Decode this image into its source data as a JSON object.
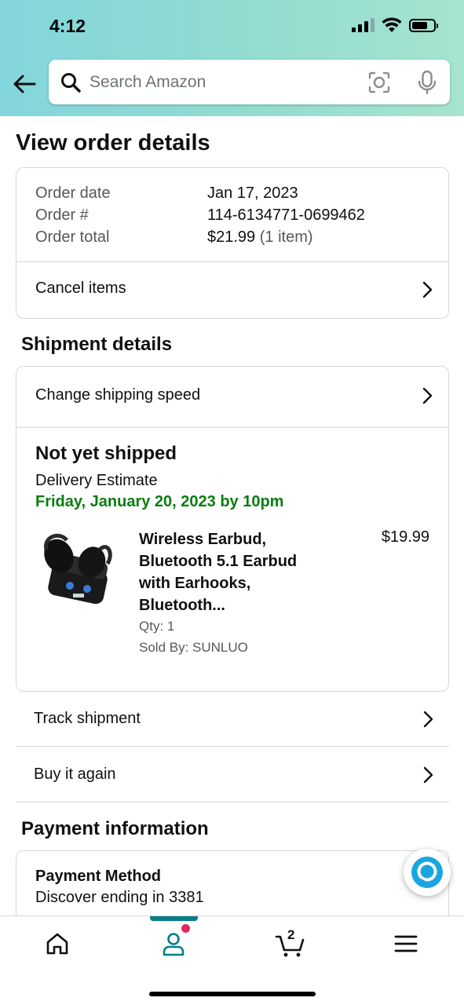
{
  "status_bar": {
    "time": "4:12"
  },
  "search": {
    "placeholder": "Search Amazon"
  },
  "page": {
    "title": "View order details"
  },
  "order": {
    "date_label": "Order date",
    "date_value": "Jan 17, 2023",
    "number_label": "Order #",
    "number_value": "114-6134771-0699462",
    "total_label": "Order total",
    "total_value": "$21.99",
    "total_items": "(1 item)",
    "cancel_label": "Cancel items"
  },
  "shipment": {
    "section_title": "Shipment details",
    "change_speed_label": "Change shipping speed",
    "status": "Not yet shipped",
    "delivery_label": "Delivery Estimate",
    "delivery_date": "Friday, January 20, 2023 by 10pm",
    "product": {
      "name": "Wireless Earbud, Bluetooth 5.1 Earbud with Earhooks, Bluetooth...",
      "price": "$19.99",
      "qty": "Qty: 1",
      "seller": "Sold By: SUNLUO"
    },
    "track_label": "Track shipment",
    "buy_again_label": "Buy it again"
  },
  "payment": {
    "section_title": "Payment information",
    "method_title": "Payment Method",
    "method_value": "Discover ending in 3381"
  },
  "bottom_nav": {
    "active_tab": "account",
    "cart_count": "2"
  },
  "colors": {
    "delivery_green": "#0a7d10",
    "accent_teal": "#067d8a",
    "notification_pink": "#e3285d"
  },
  "icons": [
    "back-arrow-icon",
    "search-icon",
    "camera-icon",
    "mic-icon",
    "chevron-right-icon",
    "alexa-icon",
    "home-icon",
    "account-icon",
    "cart-icon",
    "menu-icon"
  ]
}
